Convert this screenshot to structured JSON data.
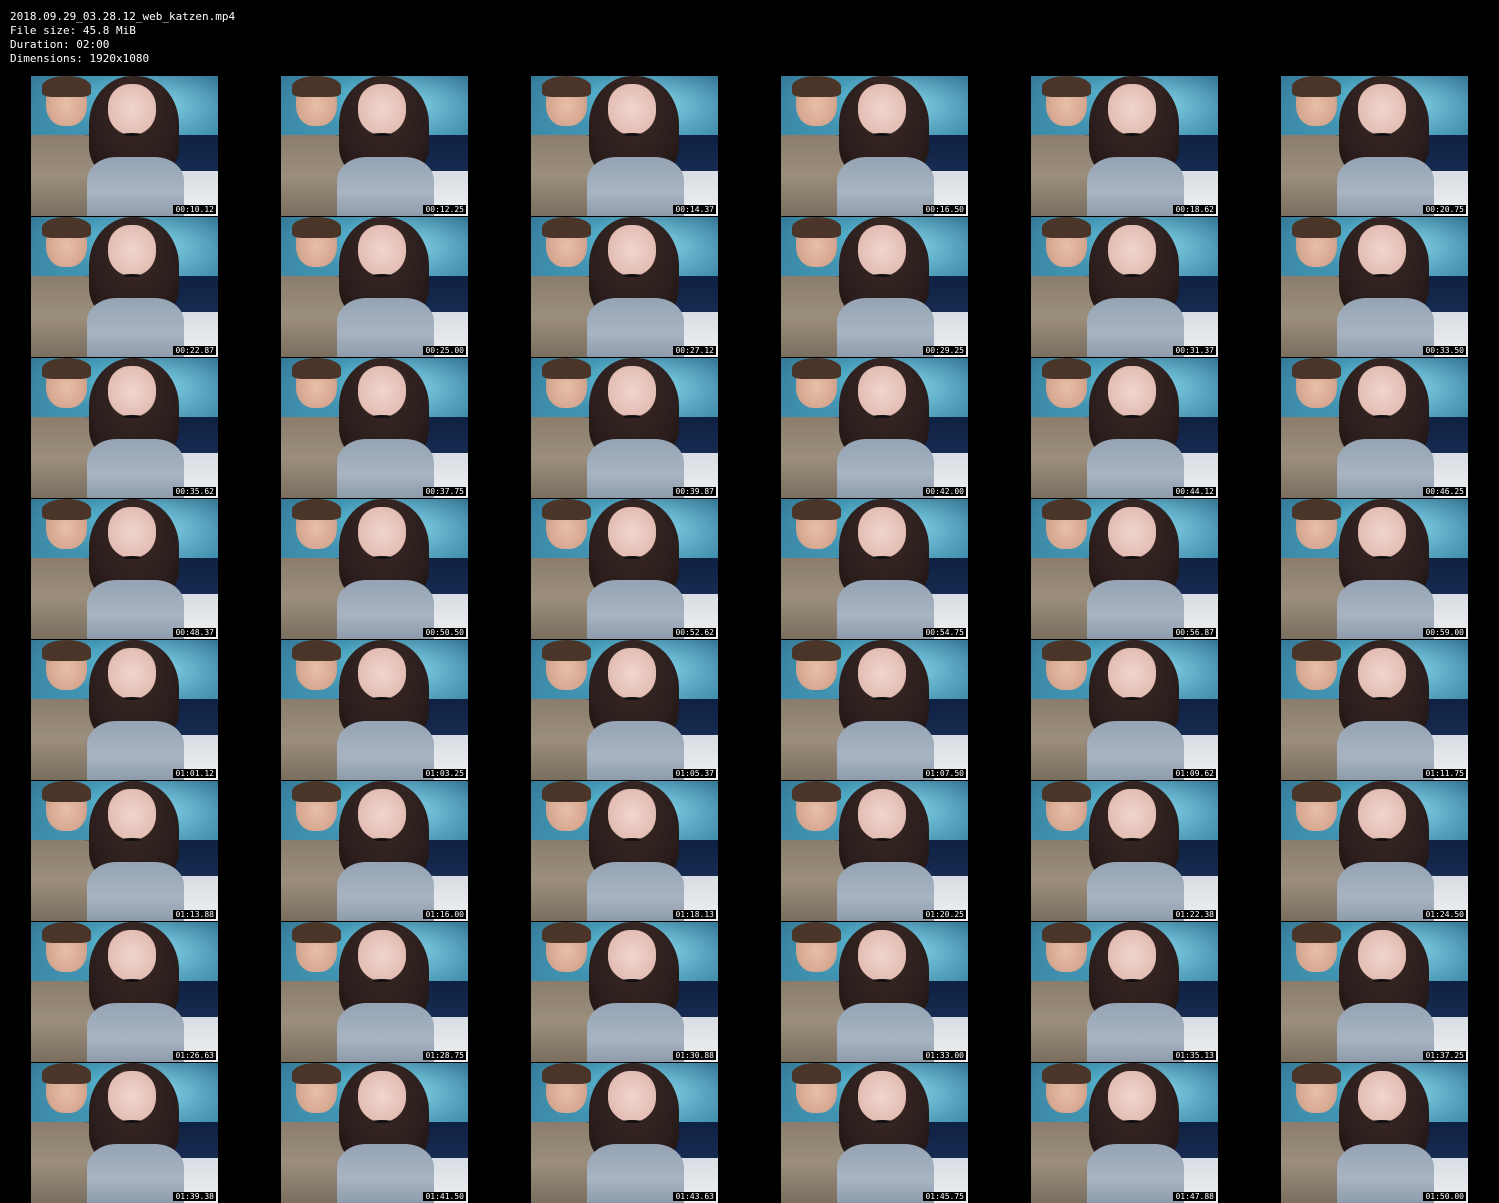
{
  "header": {
    "filename": "2018.09.29_03.28.12_web_katzen.mp4",
    "file_size": "File size: 45.8 MiB",
    "duration": "Duration: 02:00",
    "dimensions": "Dimensions: 1920x1080"
  },
  "thumbnails": [
    "00:10.12",
    "00:12.25",
    "00:14.37",
    "00:16.50",
    "00:18.62",
    "00:20.75",
    "00:22.87",
    "00:25.00",
    "00:27.12",
    "00:29.25",
    "00:31.37",
    "00:33.50",
    "00:35.62",
    "00:37.75",
    "00:39.87",
    "00:42.00",
    "00:44.12",
    "00:46.25",
    "00:48.37",
    "00:50.50",
    "00:52.62",
    "00:54.75",
    "00:56.87",
    "00:59.00",
    "01:01.12",
    "01:03.25",
    "01:05.37",
    "01:07.50",
    "01:09.62",
    "01:11.75",
    "01:13.88",
    "01:16.00",
    "01:18.13",
    "01:20.25",
    "01:22.38",
    "01:24.50",
    "01:26.63",
    "01:28.75",
    "01:30.88",
    "01:33.00",
    "01:35.13",
    "01:37.25",
    "01:39.38",
    "01:41.50",
    "01:43.63",
    "01:45.75",
    "01:47.88",
    "01:50.00"
  ]
}
